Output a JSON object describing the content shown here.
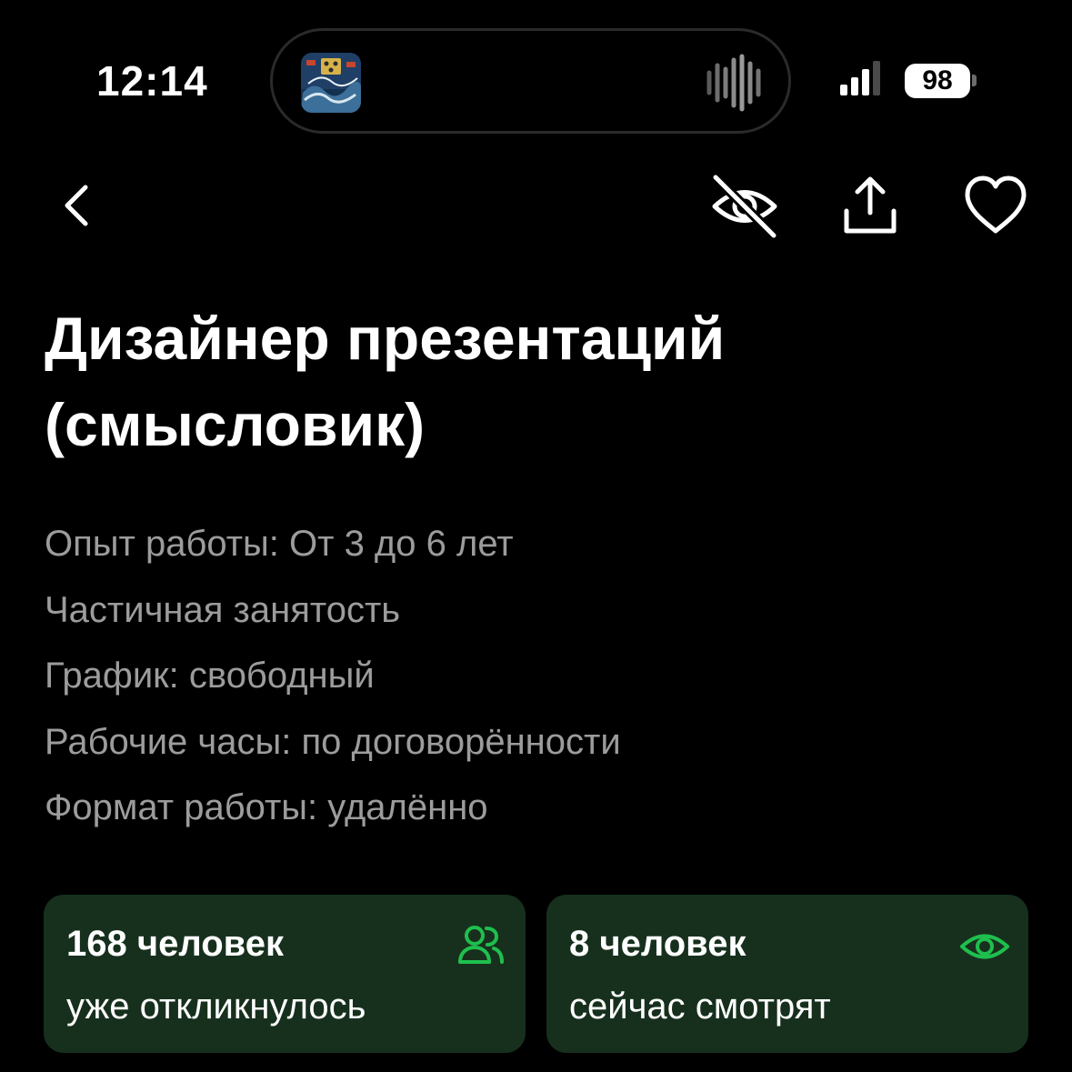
{
  "status_bar": {
    "time": "12:14",
    "battery_level": "98",
    "now_playing_icon": "album-artwork",
    "activity_icon": "audio-waveform-icon",
    "signal_icon": "cellular-signal-icon"
  },
  "nav": {
    "back_icon": "chevron-left-icon",
    "hide_icon": "eye-slash-icon",
    "share_icon": "share-icon",
    "favorite_icon": "heart-icon"
  },
  "vacancy": {
    "title": "Дизайнер презентаций (смысловик)",
    "details": [
      "Опыт работы: От 3 до 6 лет",
      "Частичная занятость",
      "График: свободный",
      "Рабочие часы: по договорённости",
      "Формат работы: удалённо"
    ]
  },
  "stats": {
    "applied": {
      "count": "168 человек",
      "caption": "уже откликнулось",
      "icon": "people-icon"
    },
    "viewing": {
      "count": "8 человек",
      "caption": "сейчас смотрят",
      "icon": "eye-icon"
    }
  },
  "colors": {
    "background": "#000000",
    "text_primary": "#ffffff",
    "text_secondary": "#9c9c9c",
    "card_background": "#17301e",
    "accent_green": "#1fbf4e"
  }
}
